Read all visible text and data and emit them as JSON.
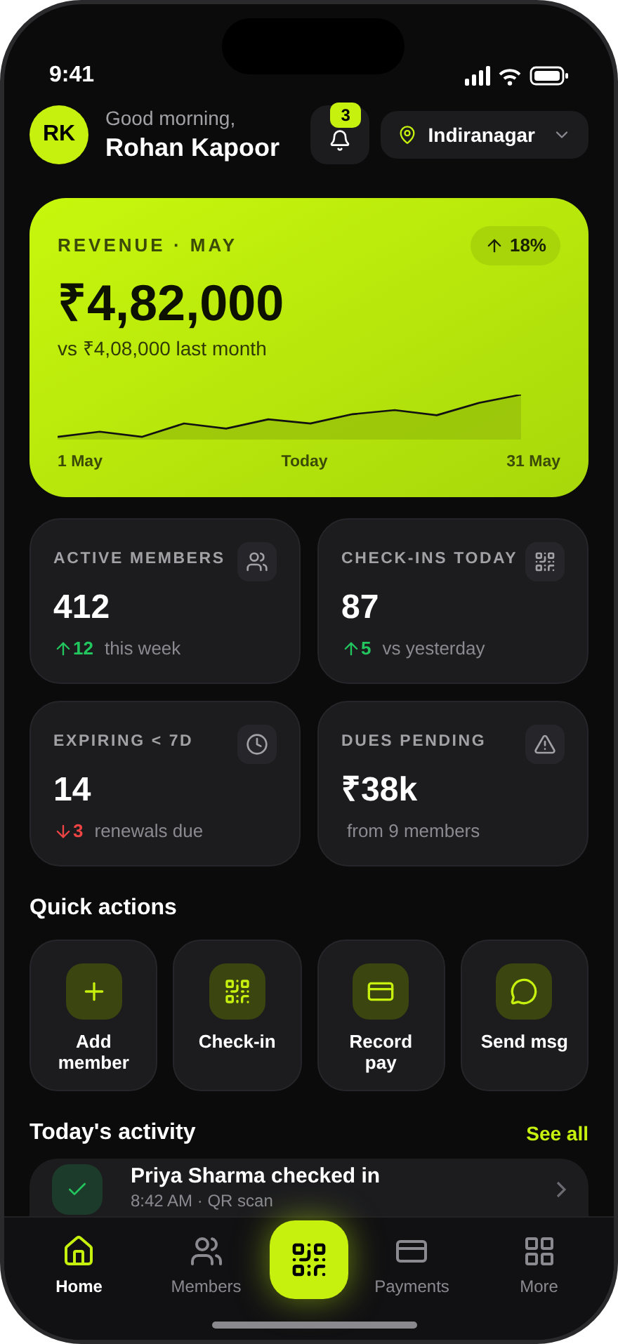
{
  "status_bar": {
    "time": "9:41"
  },
  "header": {
    "avatar_initials": "RK",
    "greeting": "Good morning,",
    "name": "Rohan Kapoor",
    "notification_count": "3",
    "location": "Indiranagar"
  },
  "revenue": {
    "title": "REVENUE · MAY",
    "change": "18%",
    "amount": "₹4,82,000",
    "comparison": "vs ₹4,08,000 last month",
    "axis_labels": [
      "1 May",
      "Today",
      "31 May"
    ]
  },
  "stats": [
    {
      "kind": "up",
      "label": "ACTIVE MEMBERS",
      "value": "412",
      "delta": "12",
      "note": "this week"
    },
    {
      "kind": "up",
      "label": "CHECK-INS TODAY",
      "value": "87",
      "delta": "5",
      "note": "vs yesterday"
    },
    {
      "kind": "down",
      "label": "EXPIRING < 7D",
      "value": "14",
      "delta": "3",
      "note": "renewals due"
    },
    {
      "kind": "plain",
      "label": "DUES PENDING",
      "value": "₹38k",
      "note": "from 9 members"
    }
  ],
  "quick_actions": {
    "title": "Quick actions",
    "items": [
      {
        "label": "Add member"
      },
      {
        "label": "Check-in"
      },
      {
        "label": "Record pay"
      },
      {
        "label": "Send msg"
      }
    ]
  },
  "activity": {
    "title": "Today's activity",
    "link": "See all",
    "items": [
      {
        "kind": "checkin",
        "title": "Priya Sharma checked in",
        "subtitle": "8:42 AM · QR scan"
      }
    ]
  },
  "tab_bar": {
    "items": [
      {
        "kind": "tab",
        "label": "Home",
        "selected": true
      },
      {
        "kind": "tab",
        "label": "Members",
        "selected": false
      },
      {
        "kind": "scan",
        "selected": false
      },
      {
        "kind": "tab",
        "label": "Payments",
        "selected": false
      },
      {
        "kind": "tab",
        "label": "More",
        "selected": false
      }
    ]
  }
}
